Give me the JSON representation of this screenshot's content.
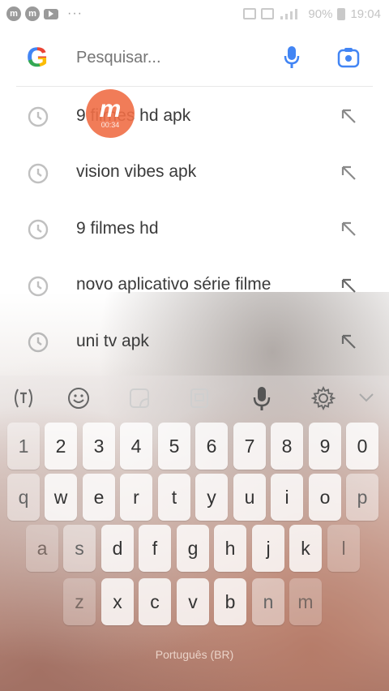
{
  "status_bar": {
    "app_icons": [
      "m",
      "m"
    ],
    "more": "···",
    "battery": "90%",
    "time": "19:04"
  },
  "search": {
    "placeholder": "Pesquisar..."
  },
  "suggestions": [
    {
      "text": "9 filmes hd apk"
    },
    {
      "text": "vision vibes apk"
    },
    {
      "text": "9 filmes hd"
    },
    {
      "text": "novo aplicativo série filme"
    },
    {
      "text": "uni tv apk"
    }
  ],
  "recorder": {
    "label": "m",
    "time": "00:34"
  },
  "keyboard": {
    "row_numbers": [
      "1",
      "2",
      "3",
      "4",
      "5",
      "6",
      "7",
      "8",
      "9",
      "0"
    ],
    "row_top": [
      "q",
      "w",
      "e",
      "r",
      "t",
      "y",
      "u",
      "i",
      "o",
      "p"
    ],
    "row_middle": [
      "a",
      "s",
      "d",
      "f",
      "g",
      "h",
      "j",
      "k",
      "l"
    ],
    "row_bottom": [
      "z",
      "x",
      "c",
      "v",
      "b",
      "n",
      "m"
    ],
    "language": "Português (BR)"
  },
  "colors": {
    "recorder": "#f06e46",
    "text": "#3a3a3a",
    "icon": "#b0b0b0"
  }
}
